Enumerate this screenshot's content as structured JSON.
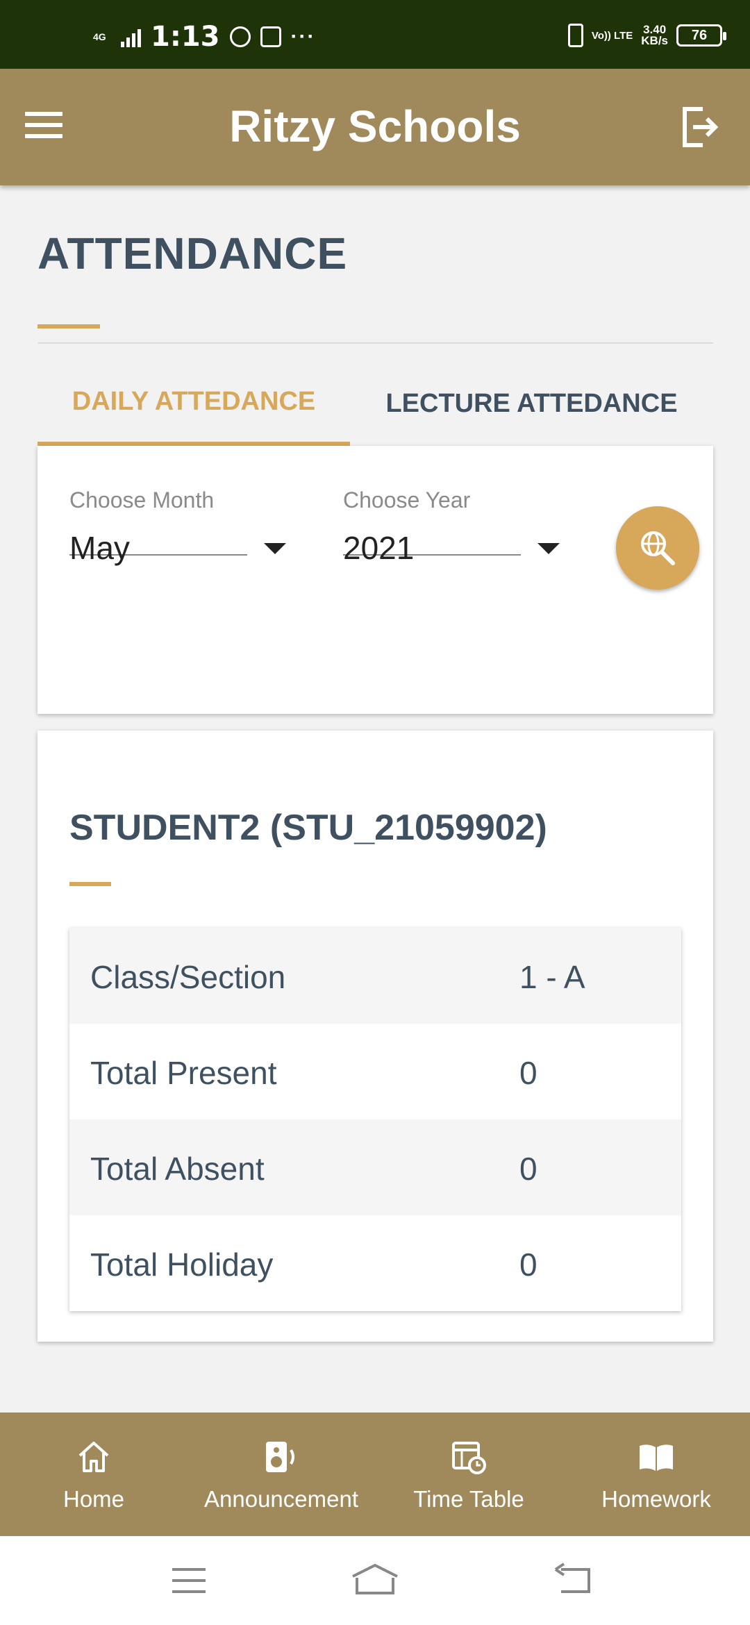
{
  "status_bar": {
    "network": "4G",
    "time": "1:13",
    "dots": "···",
    "volte": "Vo)) LTE",
    "speed_value": "3.40",
    "speed_unit": "KB/s",
    "battery": "76"
  },
  "app_bar": {
    "title": "Ritzy Schools",
    "menu_icon": "hamburger-menu-icon",
    "logout_icon": "logout-icon"
  },
  "page": {
    "title": "ATTENDANCE"
  },
  "tabs": [
    {
      "label": "DAILY ATTEDANCE",
      "active": true
    },
    {
      "label": "LECTURE ATTEDANCE",
      "active": false
    }
  ],
  "filters": {
    "month": {
      "label": "Choose Month",
      "value": "May"
    },
    "year": {
      "label": "Choose Year",
      "value": "2021"
    },
    "search_icon": "globe-search-icon"
  },
  "student": {
    "name": "STUDENT2 (STU_21059902)",
    "rows": [
      {
        "key": "Class/Section",
        "value": "1 - A"
      },
      {
        "key": "Total Present",
        "value": "0"
      },
      {
        "key": "Total Absent",
        "value": "0"
      },
      {
        "key": "Total Holiday",
        "value": "0"
      }
    ]
  },
  "bottom_nav": [
    {
      "label": "Home",
      "icon": "home-icon"
    },
    {
      "label": "Announcement",
      "icon": "speaker-icon"
    },
    {
      "label": "Time Table",
      "icon": "timetable-icon"
    },
    {
      "label": "Homework",
      "icon": "book-icon"
    }
  ],
  "colors": {
    "status_bar": "#1f3308",
    "primary": "#a08a5b",
    "accent": "#d7a75a",
    "text": "#3f5160"
  }
}
